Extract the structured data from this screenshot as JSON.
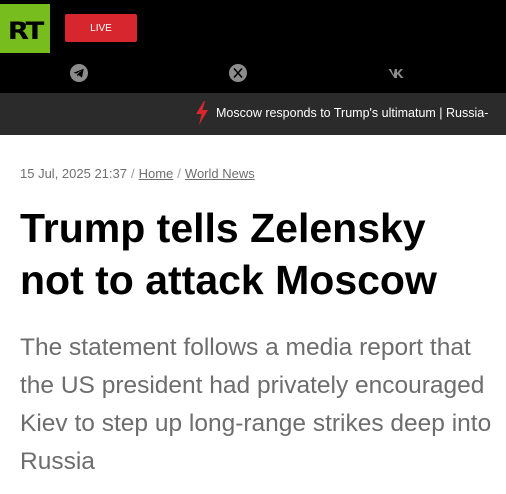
{
  "header": {
    "logo_text": "RT",
    "live_label": "LIVE",
    "social_icons": [
      "telegram-icon",
      "x-icon",
      "vk-icon"
    ],
    "colors": {
      "logo": "#77bd1e",
      "live": "#d7262d",
      "background": "#000000"
    }
  },
  "ticker": {
    "icon": "lightning-icon",
    "text": "Moscow responds to Trump's ultimatum | Russia-",
    "bolt_color": "#d7262d"
  },
  "article": {
    "date": "15 Jul, 2025 21:37",
    "breadcrumbs": [
      "Home",
      "World News"
    ],
    "headline": "Trump tells Zelensky not to attack Moscow",
    "summary": "The statement follows a media report that the US president had privately encouraged Kiev to step up long-range strikes deep into Russia"
  }
}
